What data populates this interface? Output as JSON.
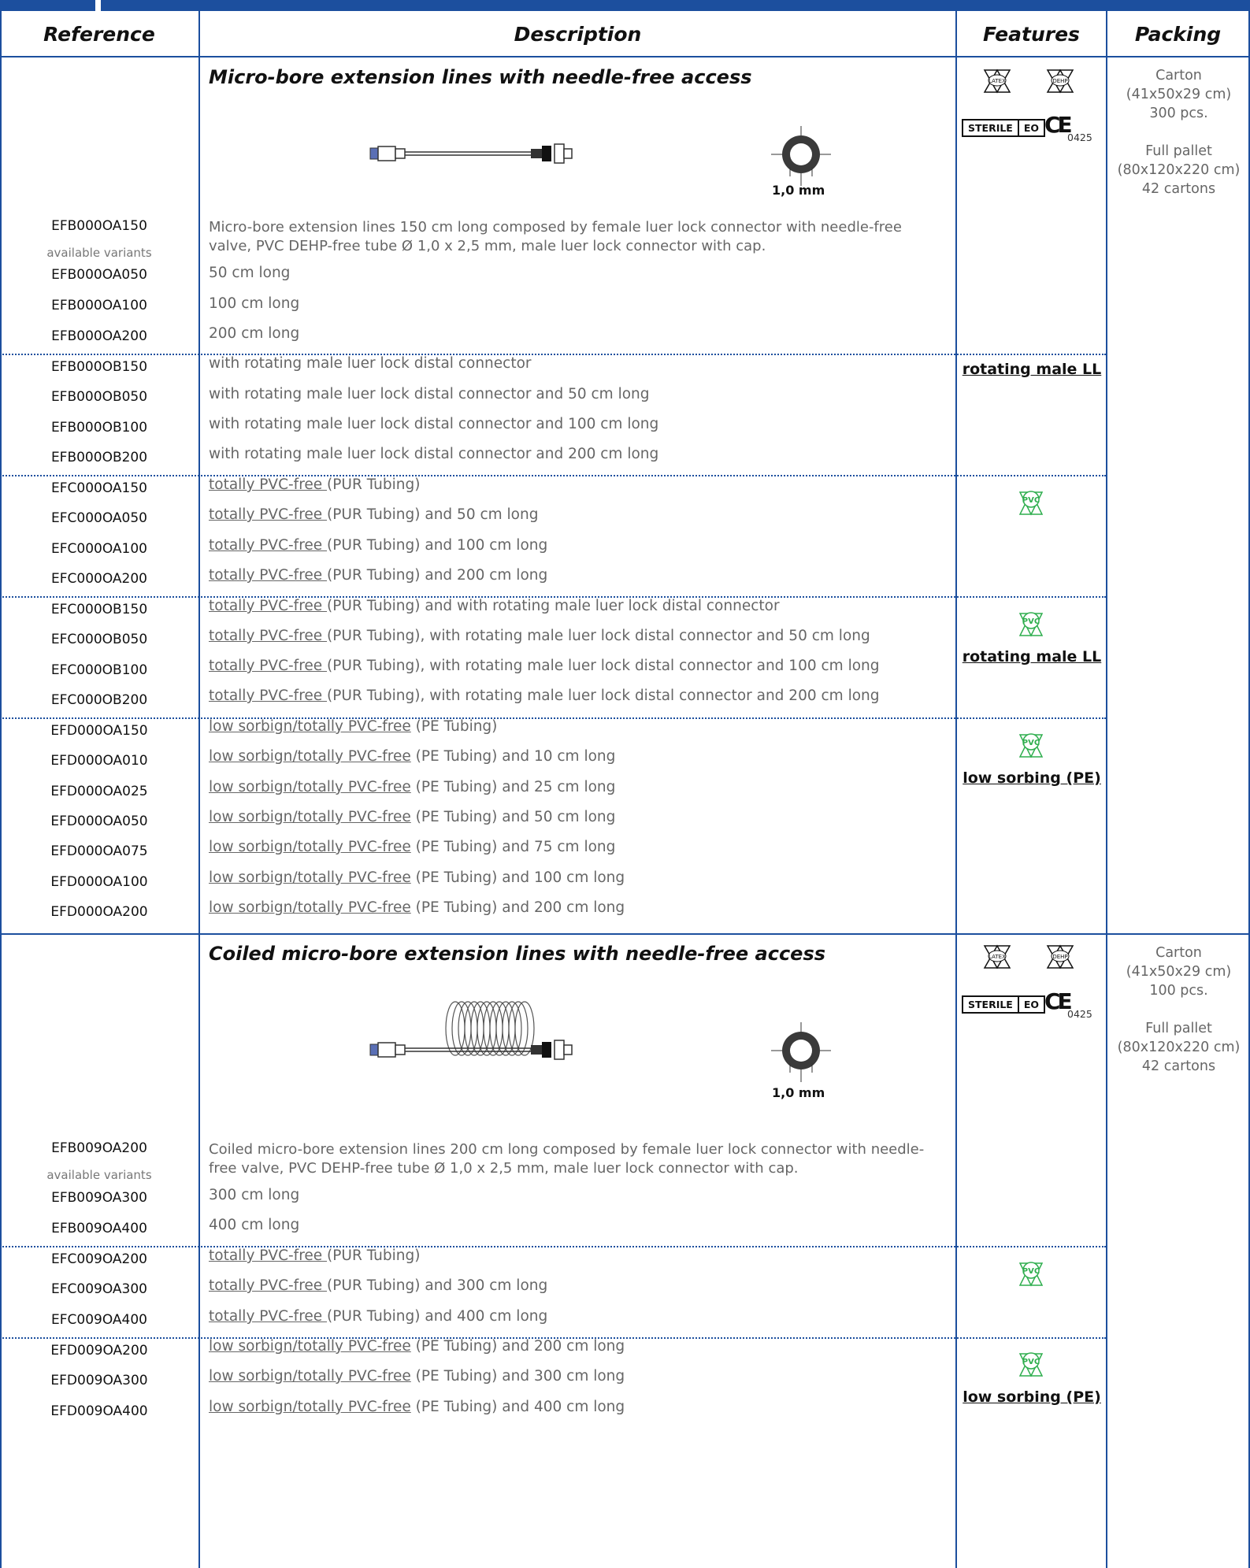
{
  "header": {
    "reference": "Reference",
    "description": "Description",
    "features": "Features",
    "packing": "Packing"
  },
  "colors": {
    "accent": "#1c4f9e",
    "pvc_green": "#2fae4e"
  },
  "section1": {
    "title": "Micro-bore extension lines with needle-free access",
    "mm_label": "1,0 mm",
    "sterile": "STERILE",
    "eo": "EO",
    "ce": "CE",
    "ce_code": "0425",
    "latex_icon": "LATEX",
    "dehp_icon": "DEHP",
    "packing": [
      "Carton",
      "(41x50x29 cm)",
      "300 pcs.",
      "",
      "Full pallet",
      "(80x120x220 cm)",
      "42 cartons"
    ],
    "main_ref": "EFB000OA150",
    "main_desc": "Micro-bore extension lines 150 cm long composed by female luer lock connector with needle-free valve, PVC DEHP-free tube Ø 1,0 x 2,5 mm, male luer lock connector with cap.",
    "available": "available variants",
    "rows_a": [
      {
        "ref": "EFB000OA050",
        "desc": "50 cm long"
      },
      {
        "ref": "EFB000OA100",
        "desc": "100 cm long"
      },
      {
        "ref": "EFB000OA200",
        "desc": "200 cm long"
      }
    ],
    "rows_b": [
      {
        "ref": "EFB000OB150",
        "desc": "with rotating male luer lock distal connector"
      },
      {
        "ref": "EFB000OB050",
        "desc": "with rotating male luer lock distal connector and 50 cm long"
      },
      {
        "ref": "EFB000OB100",
        "desc": "with rotating male luer lock distal connector and 100 cm long"
      },
      {
        "ref": "EFB000OB200",
        "desc": "with rotating male luer lock distal connector and 200 cm long"
      }
    ],
    "feat_b": "rotating male LL",
    "pvc_prefix": "totally PVC-free ",
    "rows_c": [
      {
        "ref": "EFC000OA150",
        "desc": "(PUR Tubing)"
      },
      {
        "ref": "EFC000OA050",
        "desc": "(PUR Tubing) and 50 cm long"
      },
      {
        "ref": "EFC000OA100",
        "desc": "(PUR Tubing) and 100 cm long"
      },
      {
        "ref": "EFC000OA200",
        "desc": "(PUR Tubing) and 200 cm long"
      }
    ],
    "pvc_icon": "PVC",
    "rows_d": [
      {
        "ref": "EFC000OB150",
        "desc": "(PUR Tubing) and with rotating male luer lock distal connector"
      },
      {
        "ref": "EFC000OB050",
        "desc": "(PUR Tubing), with rotating male luer lock distal connector and 50 cm long"
      },
      {
        "ref": "EFC000OB100",
        "desc": "(PUR Tubing), with rotating male luer lock distal connector and 100 cm long"
      },
      {
        "ref": "EFC000OB200",
        "desc": "(PUR Tubing), with rotating male luer lock distal connector and 200 cm long"
      }
    ],
    "feat_d": "rotating male LL",
    "sorb_prefix": "low sorbign/totally PVC-free",
    "rows_e": [
      {
        "ref": "EFD000OA150",
        "desc": " (PE Tubing)"
      },
      {
        "ref": "EFD000OA010",
        "desc": " (PE Tubing) and 10 cm long"
      },
      {
        "ref": "EFD000OA025",
        "desc": " (PE Tubing) and 25 cm long"
      },
      {
        "ref": "EFD000OA050",
        "desc": " (PE Tubing) and 50 cm long"
      },
      {
        "ref": "EFD000OA075",
        "desc": " (PE Tubing) and 75 cm long"
      },
      {
        "ref": "EFD000OA100",
        "desc": " (PE Tubing) and 100 cm long"
      },
      {
        "ref": "EFD000OA200",
        "desc": " (PE Tubing) and 200 cm long"
      }
    ],
    "feat_e": "low sorbing (PE)"
  },
  "section2": {
    "title": "Coiled micro-bore extension lines with needle-free access",
    "mm_label": "1,0 mm",
    "sterile": "STERILE",
    "eo": "EO",
    "ce": "CE",
    "ce_code": "0425",
    "latex_icon": "LATEX",
    "dehp_icon": "DEHP",
    "packing": [
      "Carton",
      "(41x50x29 cm)",
      "100 pcs.",
      "",
      "Full pallet",
      "(80x120x220 cm)",
      "42 cartons"
    ],
    "main_ref": "EFB009OA200",
    "main_desc": "Coiled micro-bore extension lines 200 cm long composed by female luer lock connector with needle-free valve, PVC DEHP-free tube Ø 1,0 x 2,5 mm, male luer lock connector with cap.",
    "available": "available variants",
    "rows_a": [
      {
        "ref": "EFB009OA300",
        "desc": "300 cm long"
      },
      {
        "ref": "EFB009OA400",
        "desc": "400 cm long"
      }
    ],
    "pvc_prefix": "totally PVC-free ",
    "rows_c": [
      {
        "ref": "EFC009OA200",
        "desc": "(PUR Tubing)"
      },
      {
        "ref": "EFC009OA300",
        "desc": "(PUR Tubing) and 300 cm long"
      },
      {
        "ref": "EFC009OA400",
        "desc": "(PUR Tubing) and 400 cm long"
      }
    ],
    "pvc_icon": "PVC",
    "sorb_prefix": "low sorbign/totally PVC-free",
    "rows_e": [
      {
        "ref": "EFD009OA200",
        "desc": " (PE Tubing) and 200 cm long"
      },
      {
        "ref": "EFD009OA300",
        "desc": " (PE Tubing) and 300 cm long"
      },
      {
        "ref": "EFD009OA400",
        "desc": " (PE Tubing) and 400 cm long"
      }
    ],
    "feat_e": "low sorbing (PE)"
  }
}
